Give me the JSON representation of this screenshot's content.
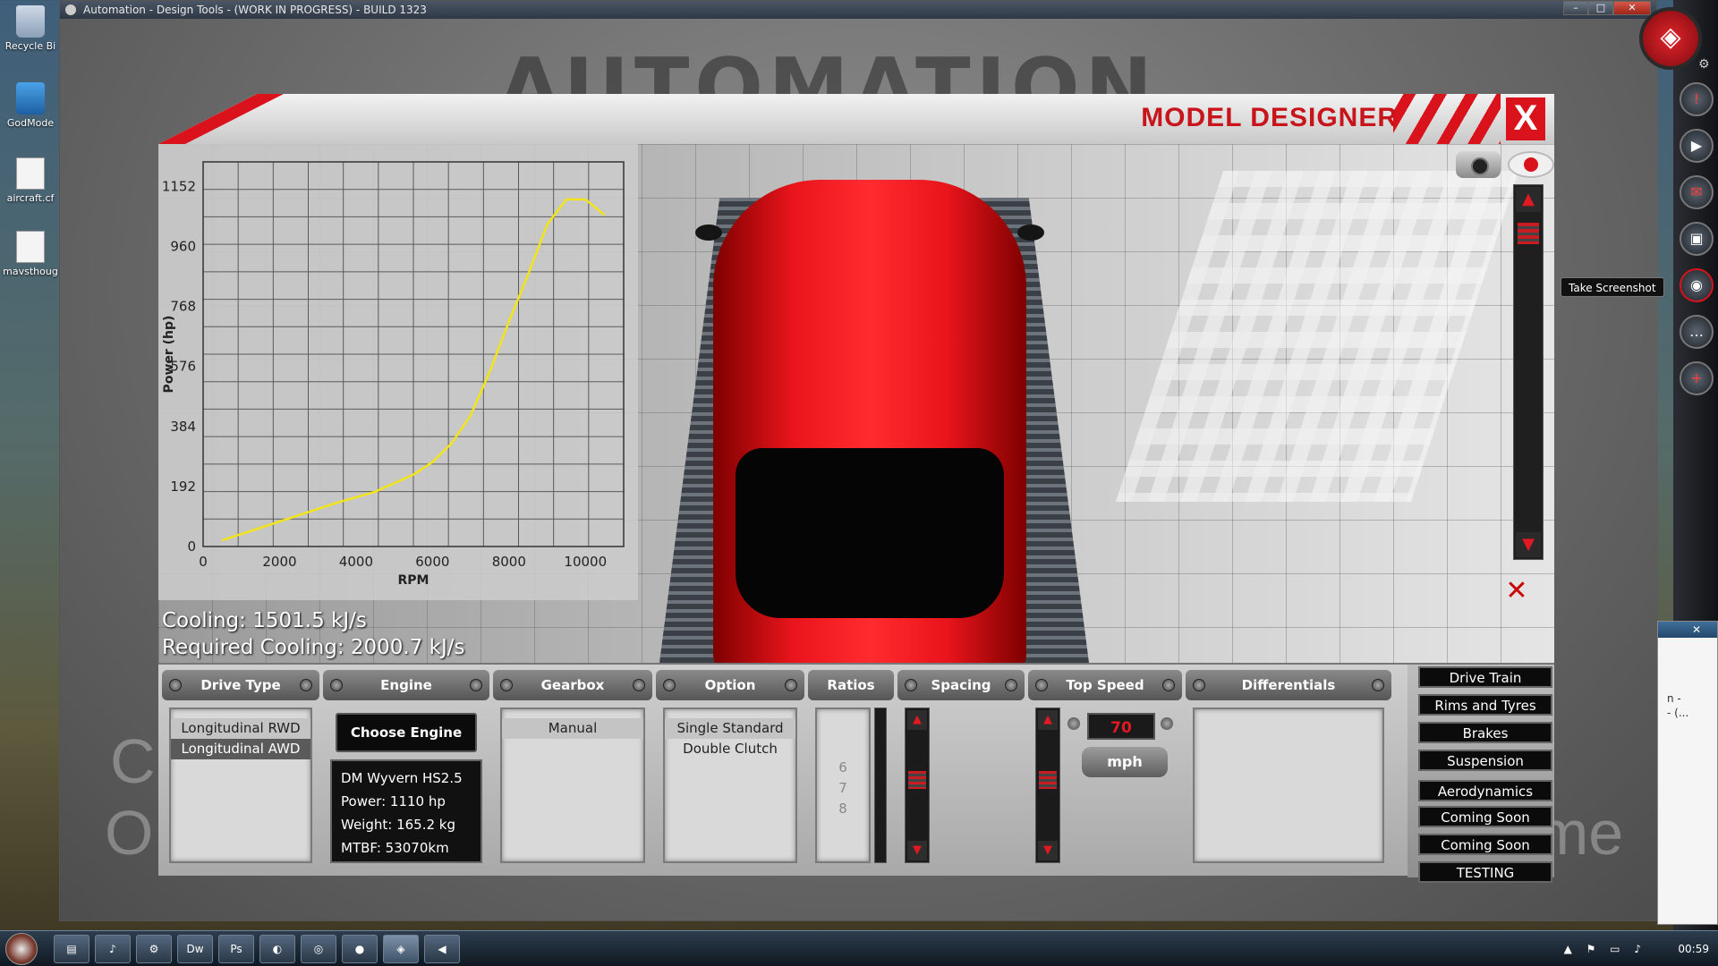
{
  "desktop": {
    "icons": [
      {
        "label": "Recycle Bi",
        "icon": "recycle-bin-icon"
      },
      {
        "label": "GodMode",
        "icon": "app-icon"
      },
      {
        "label": "aircraft.cf",
        "icon": "document-icon"
      },
      {
        "label": "mavsthoug",
        "icon": "document-icon"
      }
    ]
  },
  "window": {
    "title": "Automation - Design Tools - (WORK IN PROGRESS) - BUILD 1323",
    "controls": {
      "minimize": "–",
      "maximize": "□",
      "close": "✕"
    }
  },
  "scene": {
    "watermark": "AUTOMATION",
    "left_text_1": "C",
    "left_text_2": "O",
    "right_text": "me"
  },
  "designer": {
    "title": "MODEL DESIGNER",
    "close_label": "X",
    "cooling": "Cooling: 1501.5 kJ/s",
    "required_cooling": "Required Cooling: 2000.7 kJ/s",
    "scroll_up": "▲",
    "scroll_down": "▼",
    "reset_symbol": "✕"
  },
  "chart_data": {
    "type": "line",
    "xlabel": "RPM",
    "ylabel": "Power (hp)",
    "x_ticks": [
      "0",
      "2000",
      "4000",
      "6000",
      "8000",
      "10000"
    ],
    "y_ticks": [
      "0",
      "192",
      "384",
      "576",
      "768",
      "960",
      "1152"
    ],
    "xlim": [
      0,
      11000
    ],
    "ylim": [
      0,
      1230
    ],
    "grid": true,
    "series": [
      {
        "color": "#f2e41a",
        "x": [
          500,
          1500,
          2500,
          3500,
          4500,
          5500,
          6000,
          6500,
          7000,
          7500,
          8000,
          8500,
          9000,
          9500,
          10000,
          10300,
          10500
        ],
        "y": [
          20,
          60,
          100,
          140,
          175,
          230,
          270,
          330,
          420,
          560,
          720,
          870,
          1030,
          1110,
          1110,
          1080,
          1060
        ]
      }
    ]
  },
  "controls": {
    "drive_type": {
      "label": "Drive Type",
      "items": [
        "Longitudinal RWD",
        "Longitudinal AWD"
      ],
      "selected": 1
    },
    "engine": {
      "label": "Engine",
      "choose_label": "Choose Engine",
      "info": [
        "DM Wyvern HS2.5",
        "Power: 1110 hp",
        "Weight: 165.2 kg",
        "MTBF: 53070km"
      ]
    },
    "gearbox": {
      "label": "Gearbox",
      "items": [
        "Manual"
      ]
    },
    "option": {
      "label": "Option",
      "items": [
        "Single Standard",
        "Double Clutch"
      ]
    },
    "ratios": {
      "label": "Ratios",
      "items": [
        "6",
        "7",
        "8"
      ]
    },
    "spacing": {
      "label": "Spacing"
    },
    "top_speed": {
      "label": "Top Speed",
      "value": "70",
      "unit": "mph"
    },
    "differentials": {
      "label": "Differentials"
    },
    "stepper_up": "▲",
    "stepper_down": "▼"
  },
  "menu": {
    "items": [
      "Drive Train",
      "Rims and Tyres",
      "Brakes",
      "Suspension",
      "Aerodynamics",
      "Coming Soon",
      "Coming Soon",
      "TESTING"
    ]
  },
  "sidebar": {
    "tooltip": "Take Screenshot",
    "icons": [
      "alert-icon",
      "youtube-icon",
      "mail-icon",
      "video-icon",
      "camera-icon",
      "chat-icon",
      "add-icon"
    ],
    "popup_close": "✕",
    "popup_text_1": "n -",
    "popup_text_2": "- (..."
  },
  "taskbar": {
    "clock": "00:59",
    "apps": [
      "explorer",
      "media",
      "steam",
      "Dw",
      "Ps",
      "app",
      "chrome",
      "record",
      "automation",
      "audio"
    ]
  },
  "colors": {
    "accent_red": "#d9121b",
    "curve_yellow": "#f2e41a"
  }
}
